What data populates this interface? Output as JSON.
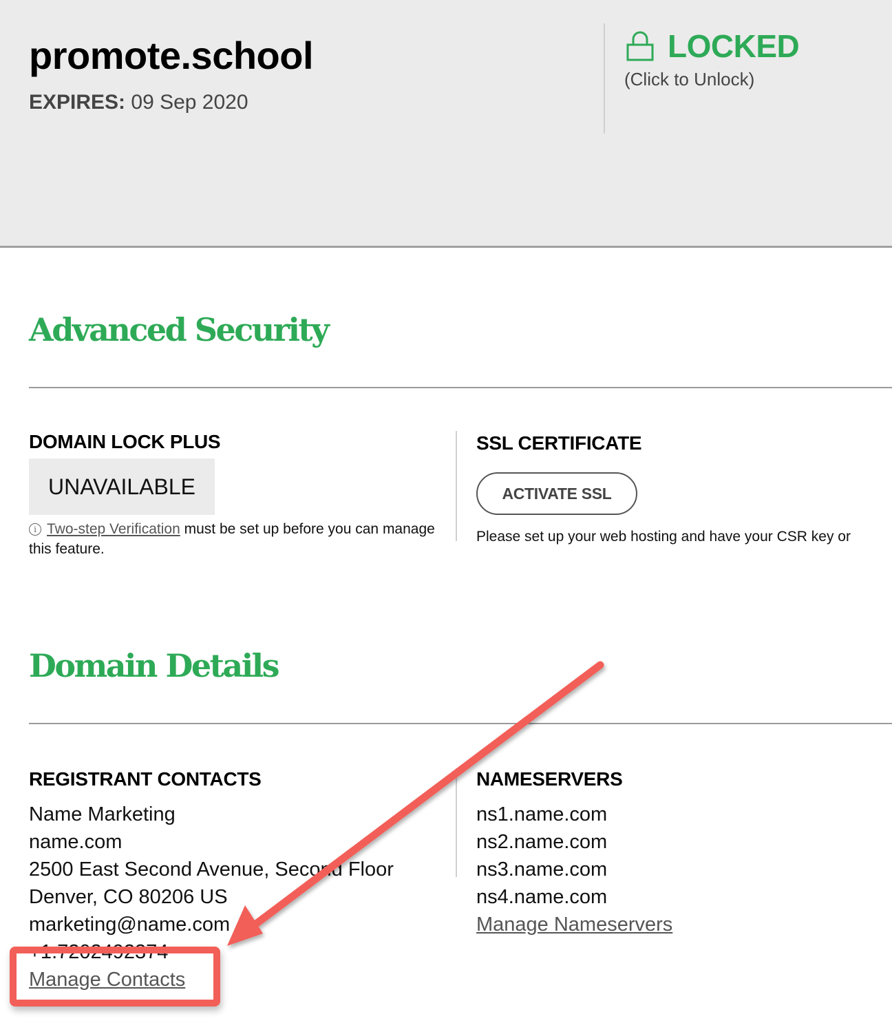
{
  "header": {
    "domain_name": "promote.school",
    "expires_label": "EXPIRES:",
    "expires_date": "09 Sep 2020",
    "lock_status": "LOCKED",
    "lock_hint": "(Click to Unlock)",
    "lock_icon": "padlock-icon",
    "accent_color": "#2eaa57"
  },
  "advanced_security": {
    "title": "Advanced Security",
    "domain_lock_plus": {
      "heading": "DOMAIN LOCK PLUS",
      "status": "UNAVAILABLE",
      "info_icon": "info-circle-icon",
      "note_link": "Two-step Verification",
      "note_text": " must be set up before you can manage this feature."
    },
    "ssl_certificate": {
      "heading": "SSL CERTIFICATE",
      "button_label": "ACTIVATE SSL",
      "note": "Please set up your web hosting and have your CSR key or"
    }
  },
  "domain_details": {
    "title": "Domain Details",
    "registrant_contacts": {
      "heading": "REGISTRANT CONTACTS",
      "lines": [
        "Name Marketing",
        "name.com",
        "2500 East Second Avenue, Second Floor",
        "Denver, CO 80206 US",
        "marketing@name.com",
        "+1.7202492374"
      ],
      "manage_link": "Manage Contacts"
    },
    "nameservers": {
      "heading": "NAMESERVERS",
      "items": [
        "ns1.name.com",
        "ns2.name.com",
        "ns3.name.com",
        "ns4.name.com"
      ],
      "manage_link": "Manage Nameservers"
    }
  },
  "annotation": {
    "highlight_color": "#f25f58",
    "target": "Manage Contacts"
  }
}
